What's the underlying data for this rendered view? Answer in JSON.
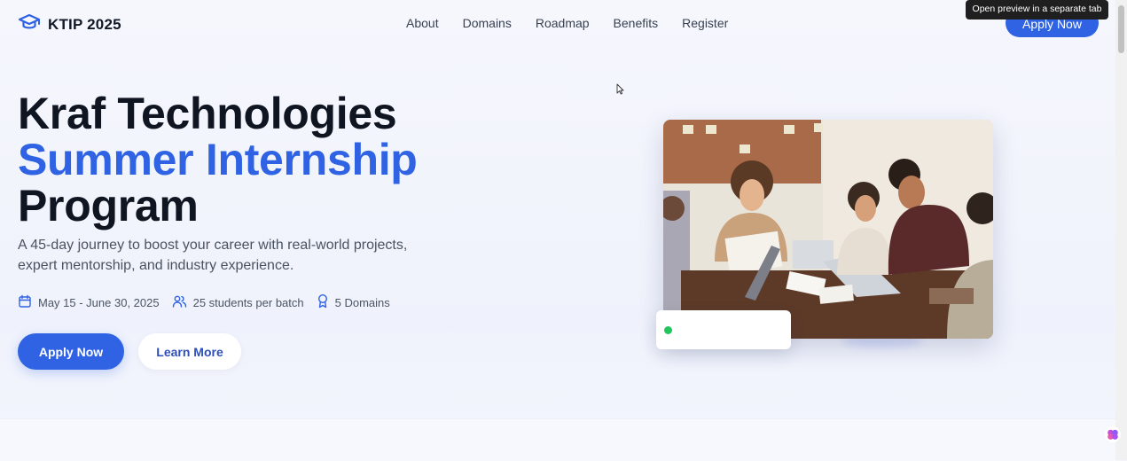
{
  "brand": {
    "name": "KTIP 2025",
    "icon": "graduation-cap-icon"
  },
  "nav": {
    "items": [
      "About",
      "Domains",
      "Roadmap",
      "Benefits",
      "Register"
    ],
    "apply_label": "Apply Now"
  },
  "tooltip": "Open preview in a separate tab",
  "hero": {
    "title_line1": "Kraf Technologies",
    "title_line2": "Summer Internship",
    "title_line3": "Program",
    "description": "A 45-day journey to boost your career with real-world projects, expert mentorship, and industry experience.",
    "meta": [
      {
        "icon": "calendar-icon",
        "text": "May 15 - June 30, 2025"
      },
      {
        "icon": "users-icon",
        "text": "25 students per batch"
      },
      {
        "icon": "award-icon",
        "text": "5 Domains"
      }
    ],
    "primary_button": "Apply Now",
    "secondary_button": "Learn More"
  },
  "colors": {
    "accent": "#2f63e3",
    "status": "#22c55e",
    "heading": "#101522"
  }
}
